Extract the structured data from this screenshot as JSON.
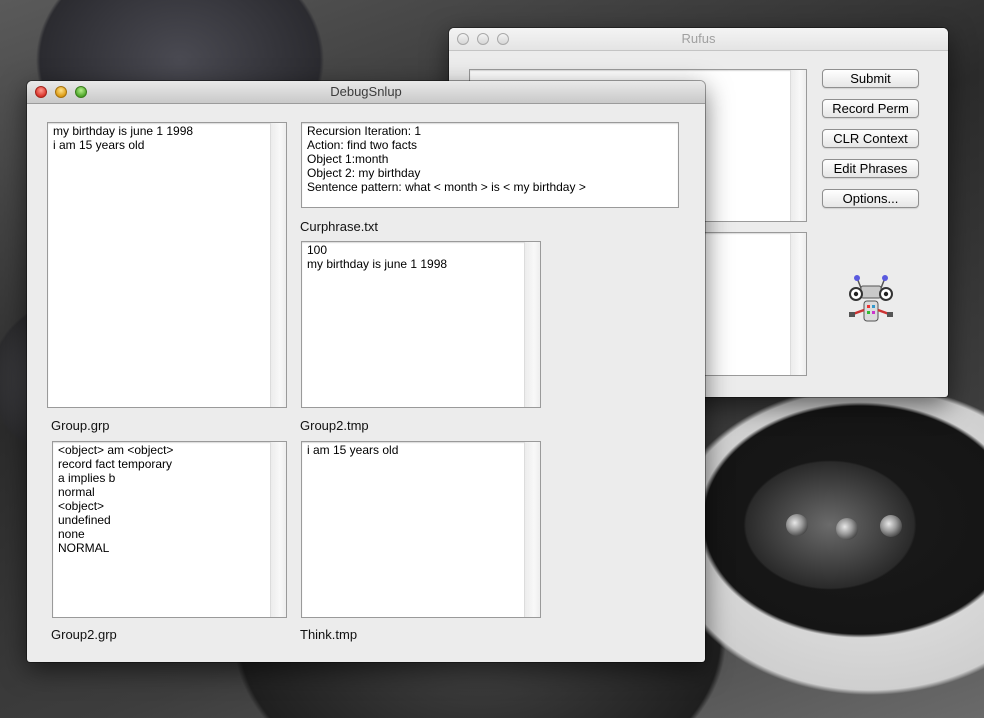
{
  "rufus": {
    "title": "Rufus",
    "buttons": {
      "submit": "Submit",
      "record_perm": "Record Perm",
      "clr_context": "CLR Context",
      "edit_phrases": "Edit Phrases",
      "options": "Options..."
    },
    "mascot_icon": "robot-icon"
  },
  "debug": {
    "title": "DebugSnlup",
    "group_grp": {
      "label": "Group.grp",
      "lines": [
        "my birthday is june 1 1998",
        "i am 15 years old"
      ]
    },
    "curphrase": {
      "label": "Curphrase.txt",
      "lines": [
        "Recursion Iteration: 1",
        "Action: find two facts",
        "Object 1:month",
        "Object 2: my birthday",
        "Sentence pattern: what < month > is < my birthday >"
      ]
    },
    "group2_tmp": {
      "label": "Group2.tmp",
      "lines": [
        "100",
        "my birthday is june 1 1998"
      ]
    },
    "group2_grp": {
      "label": "Group2.grp",
      "lines": [
        "<object> am <object>",
        "record fact temporary",
        "a implies b",
        "normal",
        "<object>",
        "undefined",
        "none",
        "NORMAL"
      ]
    },
    "think_tmp": {
      "label": "Think.tmp",
      "lines": [
        "i am 15 years old"
      ]
    }
  }
}
